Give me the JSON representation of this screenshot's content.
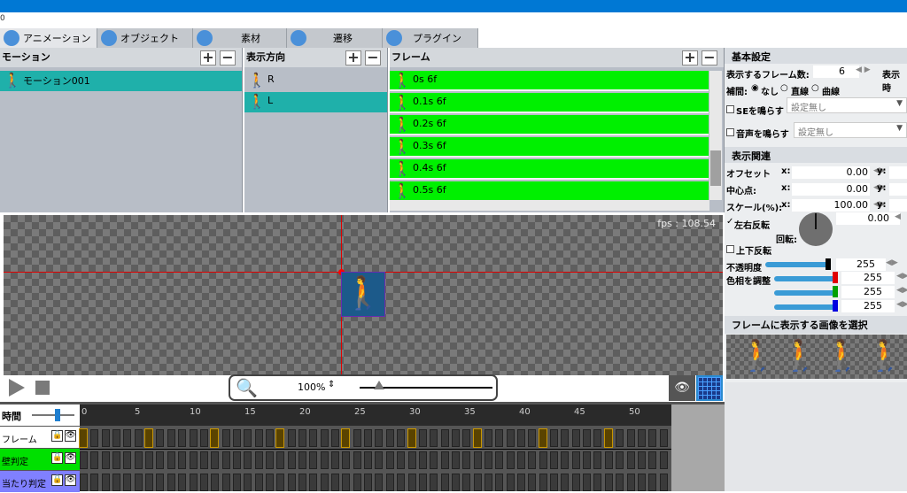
{
  "top": {
    "indicator": "0"
  },
  "tabs": [
    {
      "label": "アニメーション",
      "icon": "animation-icon"
    },
    {
      "label": "オブジェクト",
      "icon": "object-icon"
    },
    {
      "label": "素材",
      "icon": "material-icon"
    },
    {
      "label": "遷移",
      "icon": "transition-icon"
    },
    {
      "label": "プラグイン",
      "icon": "plugin-icon"
    }
  ],
  "motion": {
    "title": "モーション",
    "items": [
      "モーション001"
    ]
  },
  "direction": {
    "title": "表示方向",
    "items": [
      "R",
      "L"
    ]
  },
  "frames": {
    "title": "フレーム",
    "items": [
      "0s 6f",
      "0.1s 6f",
      "0.2s 6f",
      "0.3s 6f",
      "0.4s 6f",
      "0.5s 6f"
    ]
  },
  "canvas": {
    "fps": "fps : 108.54",
    "zoom": "100%"
  },
  "basic": {
    "title": "基本設定",
    "frame_count_label": "表示するフレーム数:",
    "frame_count": "6",
    "display_time_label": "表示時",
    "interp_label": "補間:",
    "interp_options": [
      "なし",
      "直線",
      "曲線"
    ],
    "se_label": "SEを鳴らす",
    "se_value": "設定無し",
    "sound_label": "音声を鳴らす",
    "sound_value": "設定無し"
  },
  "display": {
    "title": "表示関連",
    "offset_label": "オフセット",
    "center_label": "中心点:",
    "scale_label": "スケール(%):",
    "x": "x:",
    "y": "y:",
    "offset_x": "0.00",
    "center_x": "0.00",
    "scale_x": "100.00",
    "flip_h": "左右反転",
    "flip_v": "上下反転",
    "rotation_label": "回転:",
    "rotation": "0.00",
    "opacity_label": "不透明度",
    "opacity": "255",
    "hue_label": "色相を調整",
    "r": "255",
    "g": "255",
    "b": "255",
    "colors": {
      "red": "#e00000",
      "green": "#00a000",
      "blue": "#0000e0"
    }
  },
  "imageselect": {
    "title": "フレームに表示する画像を選択"
  },
  "timeline": {
    "time_label": "時間",
    "ticks": [
      "0",
      "5",
      "10",
      "15",
      "20",
      "25",
      "30",
      "35",
      "40",
      "45",
      "50"
    ],
    "tracks": [
      {
        "label": "フレーム",
        "color": "#ffffff"
      },
      {
        "label": "壁判定",
        "color": "#00e000"
      },
      {
        "label": "当たり判定",
        "color": "#8080ff"
      }
    ]
  }
}
